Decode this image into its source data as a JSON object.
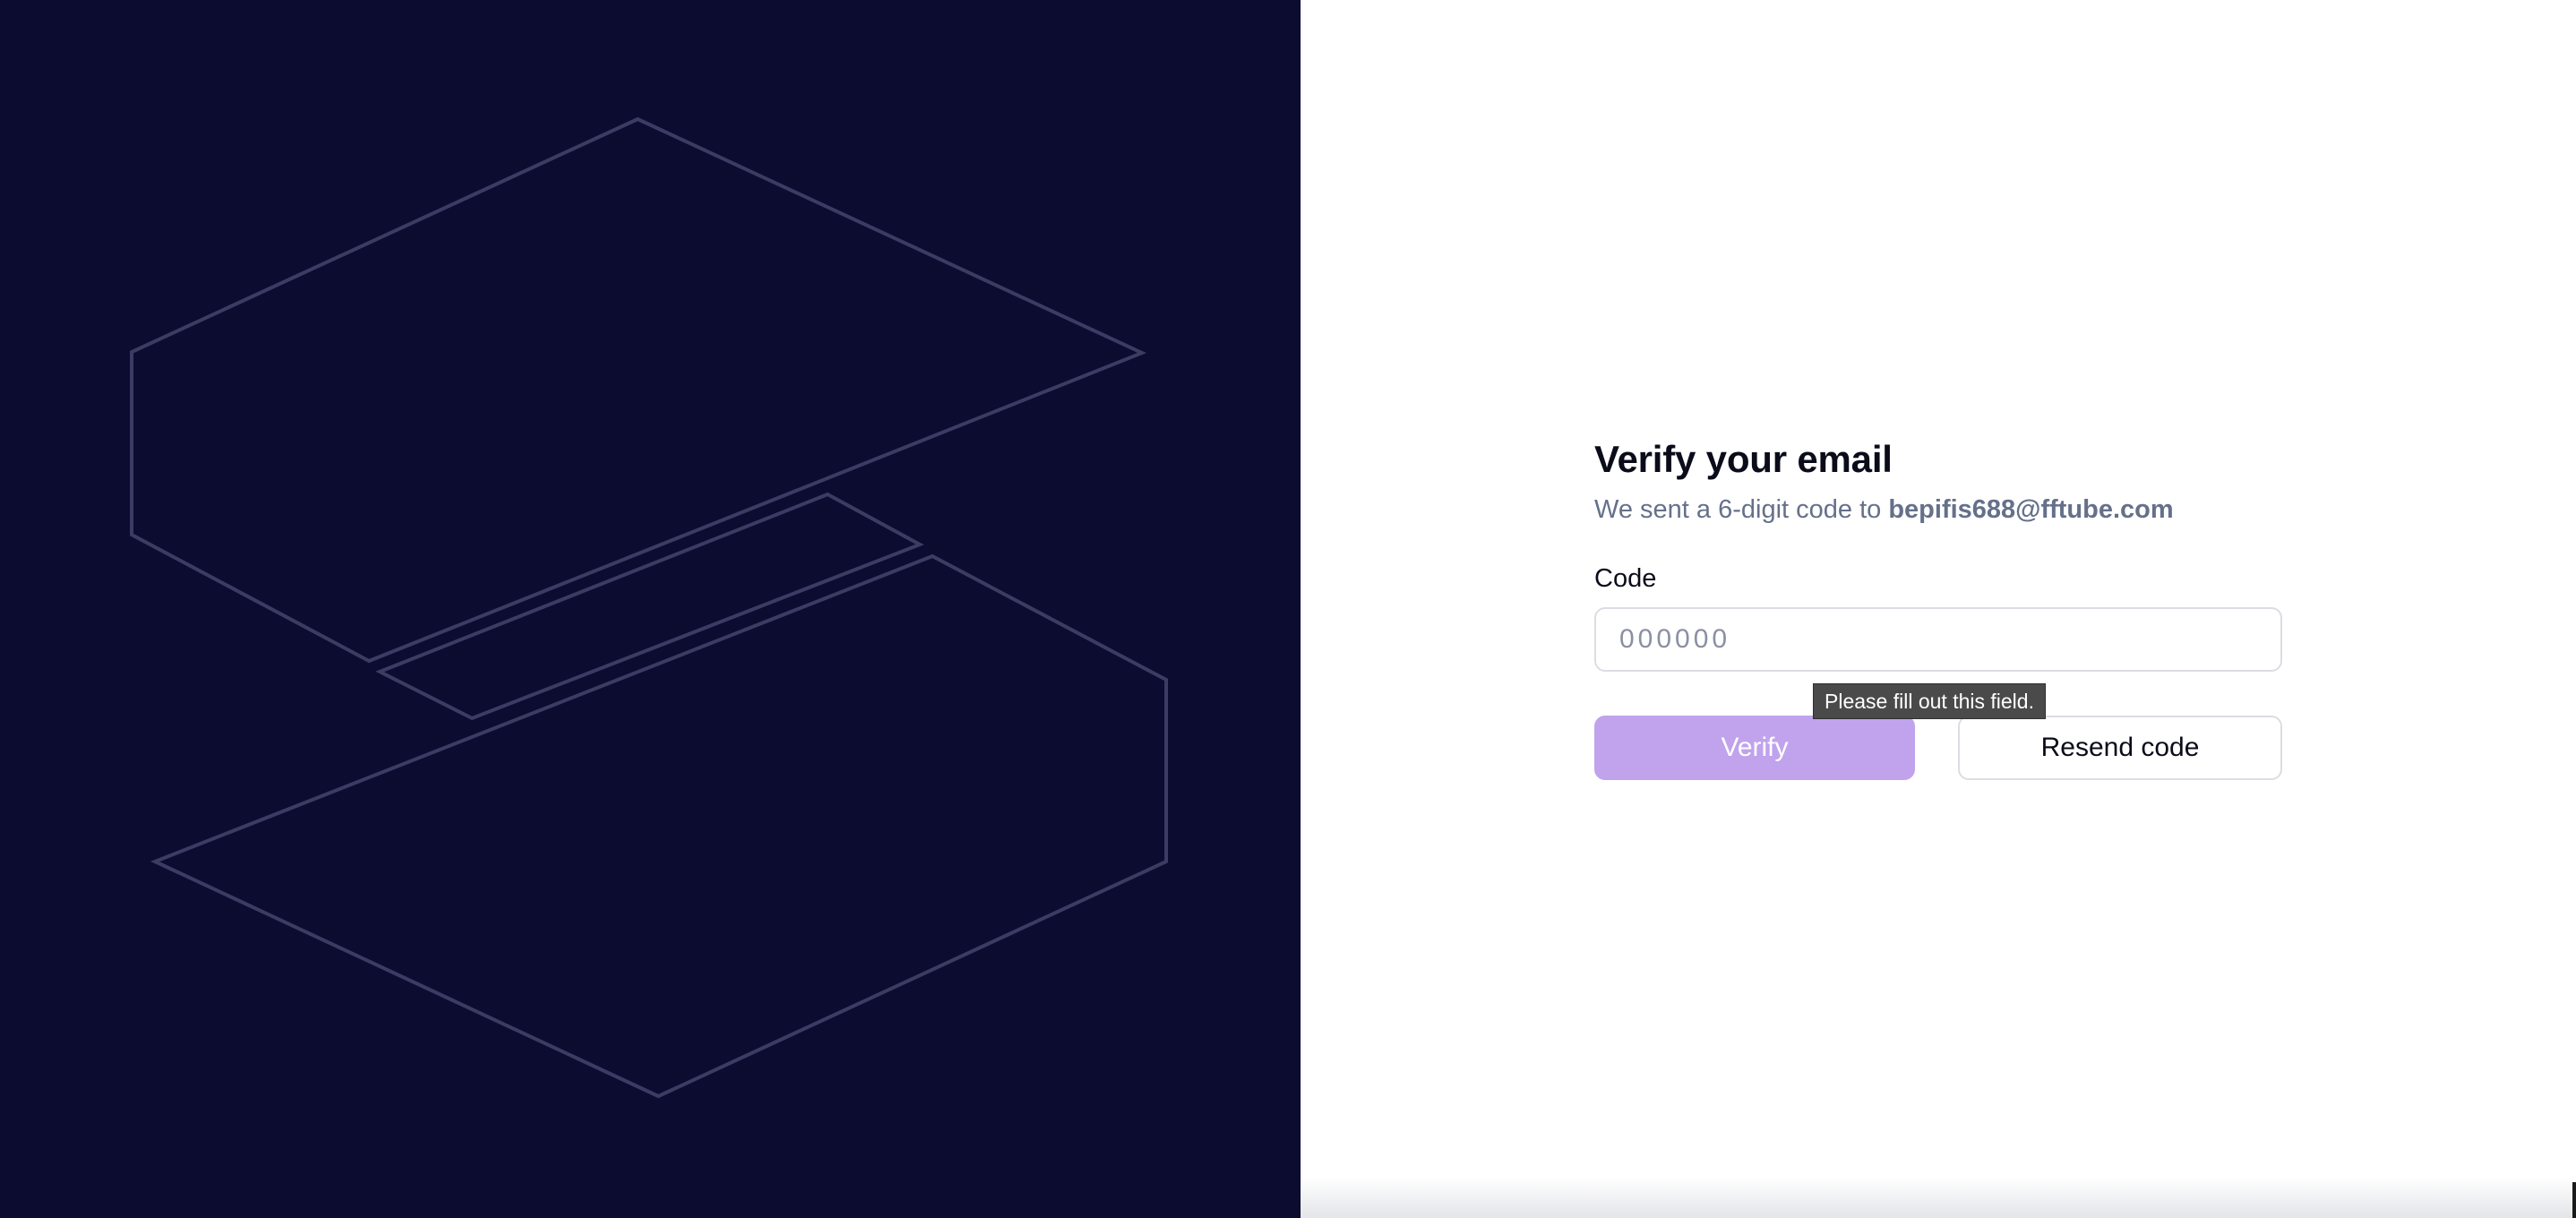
{
  "brand": {
    "panel_color": "#0b0c30",
    "logo_outline_color": "#3d3b63",
    "accent_color": "#c0a3ec"
  },
  "form": {
    "title": "Verify your email",
    "subtitle_prefix": "We sent a 6-digit code to ",
    "email": "bepifis688@fftube.com",
    "code_label": "Code",
    "code_placeholder": "000000",
    "code_value": "",
    "validation_tooltip": "Please fill out this field.",
    "verify_label": "Verify",
    "resend_label": "Resend code"
  },
  "icons": {
    "logo": "brand-logo-icon"
  }
}
